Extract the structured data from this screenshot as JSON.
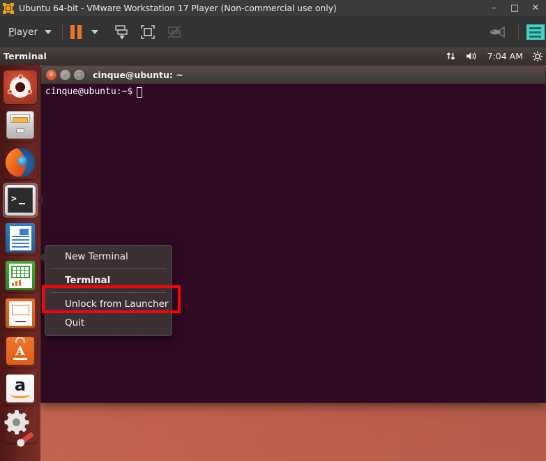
{
  "vmware": {
    "title": "Ubuntu 64-bit - VMware Workstation 17 Player (Non-commercial use only)",
    "app_icon": "vmware-icon",
    "window_controls": {
      "minimize": "–",
      "maximize": "□",
      "close": "✕"
    },
    "toolbar": {
      "player_menu_label": "Player",
      "player_menu_underline": "P",
      "buttons": [
        {
          "name": "pause-button",
          "label": "Pause"
        },
        {
          "name": "pause-dropdown",
          "label": "Pause options"
        },
        {
          "name": "send-ctrl-alt-del-button",
          "label": "Send Key"
        },
        {
          "name": "fullscreen-button",
          "label": "Enter full screen"
        },
        {
          "name": "unity-mode-button",
          "label": "Unity mode (disabled)"
        }
      ],
      "right_buttons": [
        {
          "name": "network-status-icon",
          "label": "Network"
        },
        {
          "name": "show-toolbar-icon",
          "label": "Toolbar"
        }
      ]
    }
  },
  "guest": {
    "panel": {
      "app_title": "Terminal",
      "indicators": [
        {
          "name": "network-indicator",
          "glyph": "⇅"
        },
        {
          "name": "volume-indicator",
          "glyph": "🔊"
        },
        {
          "name": "clock-indicator",
          "label": "7:04 AM"
        },
        {
          "name": "session-indicator",
          "glyph": "⚙"
        }
      ]
    },
    "launcher": {
      "items": [
        {
          "name": "launcher-item-dash",
          "label": "Ubuntu Dash",
          "icon": "ubuntu-logo-icon",
          "selected": false
        },
        {
          "name": "launcher-item-files",
          "label": "Files",
          "icon": "file-cabinet-icon",
          "selected": false
        },
        {
          "name": "launcher-item-firefox",
          "label": "Firefox Web Browser",
          "icon": "firefox-icon",
          "selected": false
        },
        {
          "name": "launcher-item-terminal",
          "label": "Terminal",
          "icon": "terminal-icon",
          "selected": true
        },
        {
          "name": "launcher-item-writer",
          "label": "LibreOffice Writer",
          "icon": "libreoffice-writer-icon",
          "selected": false
        },
        {
          "name": "launcher-item-calc",
          "label": "LibreOffice Calc",
          "icon": "libreoffice-calc-icon",
          "selected": false
        },
        {
          "name": "launcher-item-impress",
          "label": "LibreOffice Impress",
          "icon": "libreoffice-impress-icon",
          "selected": false
        },
        {
          "name": "launcher-item-software",
          "label": "Ubuntu Software Center",
          "icon": "software-center-icon",
          "selected": false
        },
        {
          "name": "launcher-item-amazon",
          "label": "Amazon",
          "icon": "amazon-icon",
          "selected": false
        },
        {
          "name": "launcher-item-settings",
          "label": "System Settings",
          "icon": "settings-gear-wrench-icon",
          "selected": false
        }
      ]
    },
    "terminal": {
      "title": "cinque@ubuntu: ~",
      "prompt": "cinque@ubuntu:~$",
      "cursor": "",
      "background_color": "#2f0a23"
    },
    "quicklist": {
      "items": [
        {
          "name": "quicklist-new-terminal",
          "label": "New Terminal",
          "bold": false,
          "separator_after": true
        },
        {
          "name": "quicklist-app-name",
          "label": "Terminal",
          "bold": true,
          "separator_after": true
        },
        {
          "name": "quicklist-unlock-from-launcher",
          "label": "Unlock from Launcher",
          "bold": false,
          "separator_after": false
        },
        {
          "name": "quicklist-quit",
          "label": "Quit",
          "bold": false,
          "separator_after": false
        }
      ],
      "highlight": {
        "target": "Unlock from Launcher",
        "color": "#f50606"
      }
    }
  }
}
